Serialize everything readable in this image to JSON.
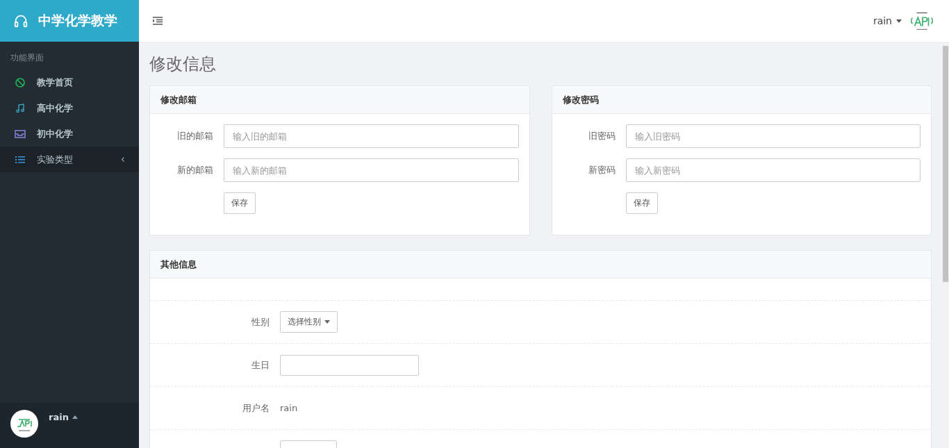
{
  "brand": {
    "title": "中学化学教学"
  },
  "sidebar": {
    "section": "功能界面",
    "items": [
      {
        "label": "教学首页",
        "color": "#1fb85a",
        "selected": false,
        "expandable": false
      },
      {
        "label": "高中化学",
        "color": "#3aa6c4",
        "selected": false,
        "expandable": false
      },
      {
        "label": "初中化学",
        "color": "#6f6fb5",
        "selected": false,
        "expandable": false
      },
      {
        "label": "实验类型",
        "color": "#3a8fd0",
        "selected": true,
        "expandable": true
      }
    ],
    "user": {
      "name": "rain"
    }
  },
  "topbar": {
    "user": "rain"
  },
  "page": {
    "title": "修改信息"
  },
  "panels": [
    {
      "title": "修改邮箱",
      "fields": [
        {
          "label": "旧的邮箱",
          "placeholder": "输入旧的邮箱"
        },
        {
          "label": "新的邮箱",
          "placeholder": "输入新的邮箱"
        }
      ],
      "button": "保存"
    },
    {
      "title": "修改密码",
      "fields": [
        {
          "label": "旧密码",
          "placeholder": "输入旧密码"
        },
        {
          "label": "新密码",
          "placeholder": "输入新密码"
        }
      ],
      "button": "保存"
    }
  ],
  "other": {
    "title": "其他信息",
    "rows": [
      {
        "kind": "select",
        "label": "性别",
        "value": "选择性别"
      },
      {
        "kind": "input",
        "label": "生日"
      },
      {
        "kind": "text",
        "label": "用户名",
        "value": "rain"
      },
      {
        "kind": "select"
      }
    ]
  }
}
